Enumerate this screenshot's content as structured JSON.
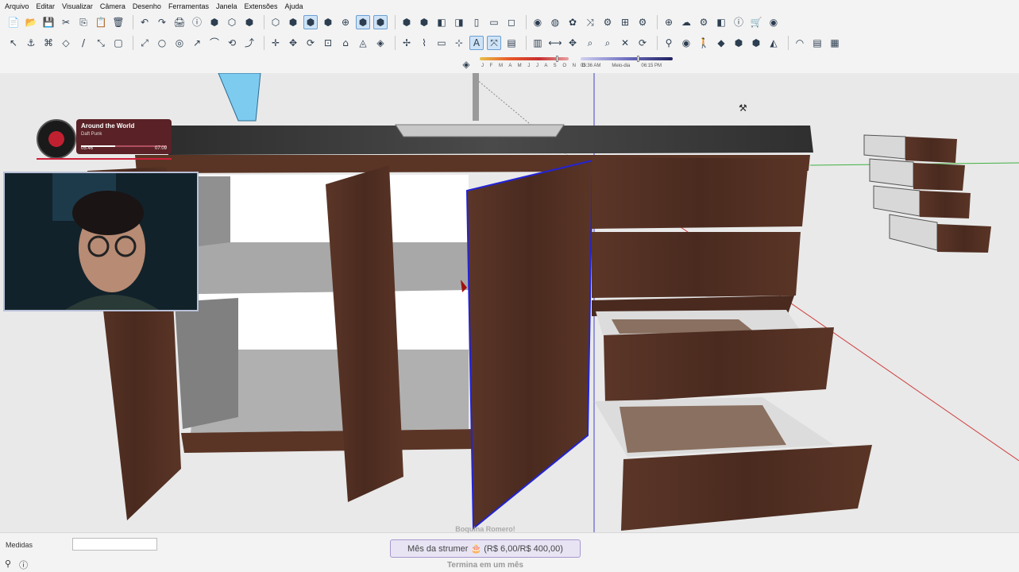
{
  "menu": [
    "Arquivo",
    "Editar",
    "Visualizar",
    "Câmera",
    "Desenho",
    "Ferramentas",
    "Janela",
    "Extensões",
    "Ajuda"
  ],
  "toolbar1": [
    "📄",
    "📂",
    "💾",
    "✂",
    "⎘",
    "📋",
    "🗑",
    "↶",
    "↷",
    "🖨",
    "ⓘ",
    "⬢",
    "⬡",
    "⬢",
    "⬡",
    "⬢",
    "⬢",
    "⬢",
    "⊕",
    "⬢",
    "⬢",
    "⬢",
    "⬢",
    "◧",
    "◨",
    "▯",
    "▭",
    "◻",
    "◉",
    "◍",
    "✿",
    "⤨",
    "⚙",
    "⊞",
    "⚙",
    "⊕",
    "☁",
    "⚙",
    "◧",
    "ⓘ",
    "🛒",
    "◉"
  ],
  "toolbar2": [
    "↖",
    "⚓",
    "⌘",
    "◇",
    "/",
    "⤡",
    "▢",
    "⤢",
    "○",
    "◎",
    "↗",
    "⌒",
    "⟲",
    "⤴",
    "✛",
    "✥",
    "⟳",
    "⊡",
    "⌂",
    "◬",
    "◈",
    "✢",
    "⌇",
    "▭",
    "⊹",
    "A",
    "⤧",
    "▤",
    "▥",
    "⟷",
    "✥",
    "⌕",
    "⌕",
    "✕",
    "⟳",
    "⚲",
    "◉",
    "🚶",
    "◆",
    "⬢",
    "⬢",
    "◭",
    "◠",
    "▤",
    "▦"
  ],
  "shadow": {
    "months": "J F M A M J J A S O N D",
    "time_start": "05:36 AM",
    "time_mid": "Meio-dia",
    "time_end": "06:15 PM"
  },
  "music": {
    "song": "Around the World",
    "artist": "Daft Punk",
    "elapsed": "05:46",
    "total": "07:09",
    "progress": 0.4
  },
  "status": {
    "measure_label": "Medidas",
    "measure_value": "",
    "donation_header": "Boquina Romero!",
    "donation": "Mês da strumer 🎂 (R$ 6,00/R$ 400,00)",
    "donation_sub": "Termina em um mês",
    "icons": [
      "⚲",
      "ⓘ"
    ]
  },
  "colors": {
    "selection": "#2323d6",
    "wood": "#4e2e22",
    "countertop": "#3a3a3a"
  }
}
